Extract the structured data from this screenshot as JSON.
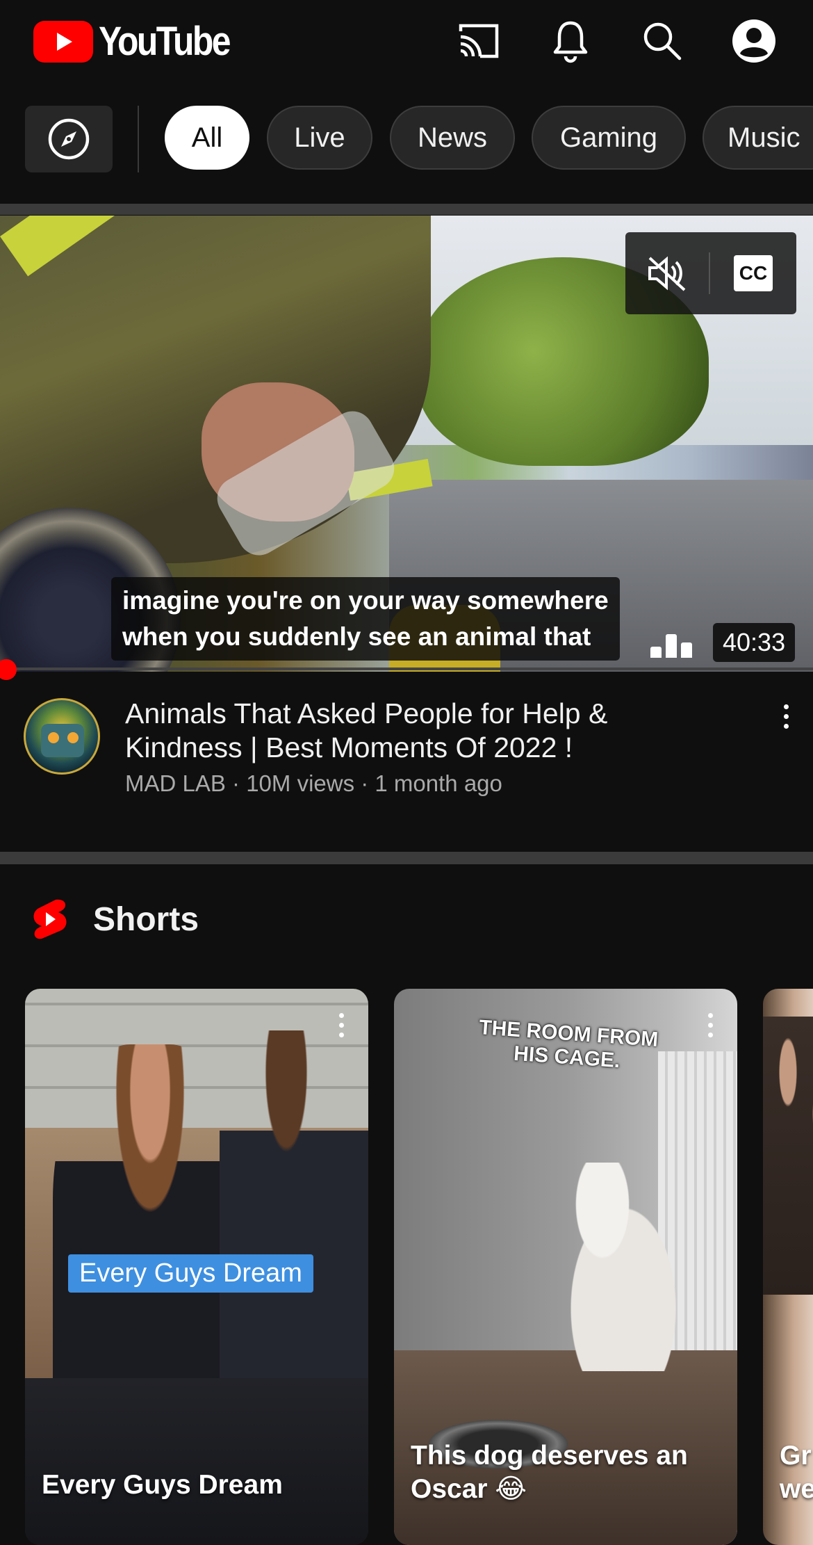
{
  "header": {
    "logo_text": "YouTube",
    "icons": [
      "cast-icon",
      "notifications-icon",
      "search-icon",
      "account-icon"
    ]
  },
  "chips": {
    "explore_icon": "compass-icon",
    "items": [
      {
        "label": "All",
        "active": true
      },
      {
        "label": "Live",
        "active": false
      },
      {
        "label": "News",
        "active": false
      },
      {
        "label": "Gaming",
        "active": false
      },
      {
        "label": "Music",
        "active": false
      }
    ]
  },
  "video": {
    "subtitle_line1": "imagine you're on your way somewhere",
    "subtitle_line2": "when you suddenly see an animal that",
    "duration": "40:33",
    "cc_label": "CC",
    "title_line1": "Animals That Asked People for Help &",
    "title_line2": "Kindness | Best Moments Of 2022 !",
    "meta": "MAD LAB · 10M views · 1 month ago",
    "muted": true
  },
  "shorts": {
    "heading": "Shorts",
    "items": [
      {
        "overlay_label": "Every Guys Dream",
        "caption": "Every Guys Dream"
      },
      {
        "overlay_label": "THE ROOM FROM HIS CAGE.",
        "caption": "This dog deserves an Oscar 😂"
      },
      {
        "caption": "Gr we"
      }
    ]
  },
  "colors": {
    "background": "#0f0f0f",
    "brand_red": "#ff0000",
    "chip_bg": "#272727",
    "secondary_text": "#aaaaaa"
  }
}
